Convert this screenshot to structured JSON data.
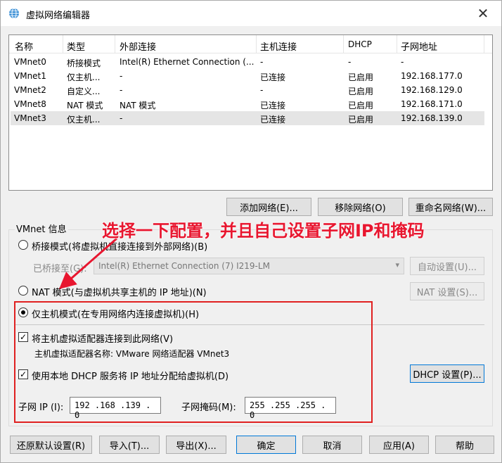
{
  "window": {
    "title": "虚拟网络编辑器",
    "close": "✕"
  },
  "table": {
    "headers": [
      "名称",
      "类型",
      "外部连接",
      "主机连接",
      "DHCP",
      "子网地址"
    ],
    "rows": [
      [
        "VMnet0",
        "桥接模式",
        "Intel(R) Ethernet Connection (...",
        "-",
        "-",
        "-"
      ],
      [
        "VMnet1",
        "仅主机...",
        "-",
        "已连接",
        "已启用",
        "192.168.177.0"
      ],
      [
        "VMnet2",
        "自定义...",
        "-",
        "-",
        "已启用",
        "192.168.129.0"
      ],
      [
        "VMnet8",
        "NAT 模式",
        "NAT 模式",
        "已连接",
        "已启用",
        "192.168.171.0"
      ],
      [
        "VMnet3",
        "仅主机...",
        "-",
        "已连接",
        "已启用",
        "192.168.139.0"
      ]
    ],
    "selected_row": 4
  },
  "buttons": {
    "add_network": "添加网络(E)...",
    "remove_network": "移除网络(O)",
    "rename_network": "重命名网络(W)...",
    "auto_settings": "自动设置(U)...",
    "nat_settings": "NAT 设置(S)...",
    "dhcp_settings": "DHCP 设置(P)...",
    "restore_defaults": "还原默认设置(R)",
    "import": "导入(T)...",
    "export": "导出(X)...",
    "ok": "确定",
    "cancel": "取消",
    "apply": "应用(A)",
    "help": "帮助"
  },
  "vmnet_info": {
    "group_label": "VMnet 信息",
    "bridged_label": "桥接模式(将虚拟机直接连接到外部网络)(B)",
    "bridged_to_label": "已桥接至(G):",
    "bridged_to_value": "Intel(R) Ethernet Connection (7) I219-LM",
    "nat_label": "NAT 模式(与虚拟机共享主机的 IP 地址)(N)",
    "host_only_label": "仅主机模式(在专用网络内连接虚拟机)(H)",
    "connect_adapter_label": "将主机虚拟适配器连接到此网络(V)",
    "adapter_name_label": "主机虚拟适配器名称: VMware 网络适配器 VMnet3",
    "dhcp_label": "使用本地 DHCP 服务将 IP 地址分配给虚拟机(D)",
    "subnet_ip_label": "子网 IP (I):",
    "subnet_ip_value": "192 .168 .139 . 0",
    "subnet_mask_label": "子网掩码(M):",
    "subnet_mask_value": "255 .255 .255 . 0",
    "selected_mode": "host_only",
    "connect_adapter_checked": true,
    "dhcp_checked": true
  },
  "annotation": {
    "text": "选择一下配置，并且自己设置子网IP和掩码",
    "color": "#e8162f"
  }
}
